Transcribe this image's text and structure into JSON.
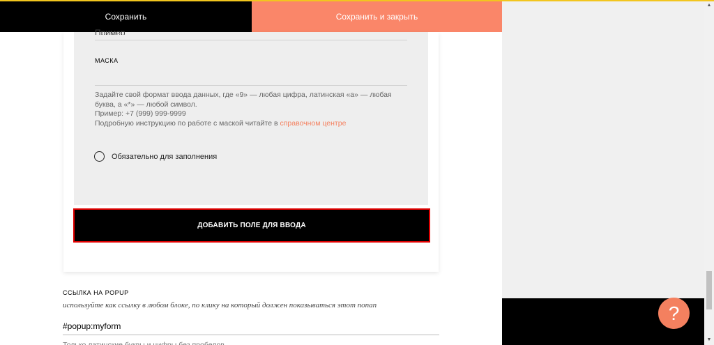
{
  "header": {
    "save_label": "Сохранить",
    "save_close_label": "Сохранить и закрыть"
  },
  "form": {
    "cut_text": "Пример",
    "mask": {
      "label": "МАСКА",
      "value": "",
      "help_line1": "Задайте свой формат ввода данных, где «9» — любая цифра, латинская «a» — любая буква, а «*» — любой символ.",
      "help_line2": "Пример: +7 (999) 999-9999",
      "help_line3": "Подробную инструкцию по работе с маской читайте в ",
      "help_link": "справочном центре"
    },
    "required_label": "Обязательно для заполнения",
    "add_field_label": "ДОБАВИТЬ ПОЛЕ ДЛЯ ВВОДА"
  },
  "popup": {
    "label": "ССЫЛКА НА POPUP",
    "hint": "используйте как ссылку в любом блоке, по клику на который должен показываться этот попап",
    "value": "#popup:myform",
    "note": "Только латинские буквы и цифры без пробелов"
  },
  "help_button": "?",
  "colors": {
    "accent": "#fa8669",
    "link": "#f4805f",
    "highlight_border": "#e00000",
    "top_line": "#f2c51e"
  }
}
